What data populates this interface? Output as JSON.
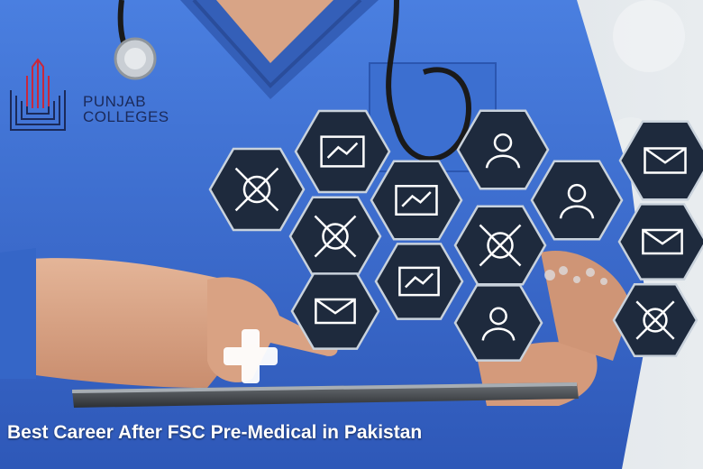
{
  "logo": {
    "line1": "PUNJAB",
    "line2": "COLLEGES"
  },
  "caption": "Best Career After FSC Pre-Medical in Pakistan",
  "colors": {
    "scrubs": "#3a6fd0",
    "hexagon": "#1e2a3d",
    "icon_line": "#ffffff",
    "logo_red": "#c8283c",
    "logo_navy": "#1b2a5a"
  },
  "icons": [
    "drone-network-icon",
    "code-icon",
    "robot-phone-icon",
    "team-icon",
    "social-media-icon",
    "email-marketing-icon",
    "chain-link-icon",
    "idea-bulb-icon",
    "analytics-monitor-icon",
    "network-user-icon",
    "pie-chart-icon",
    "notebook-pen-icon",
    "video-megaphone-icon"
  ]
}
